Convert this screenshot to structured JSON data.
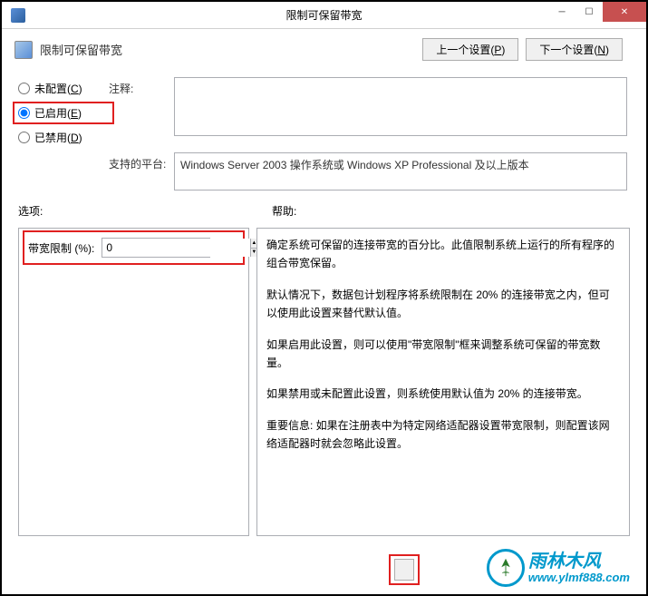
{
  "window": {
    "title": "限制可保留带宽"
  },
  "header": {
    "title": "限制可保留带宽",
    "prev_btn": "上一个设置(",
    "prev_accel": "P",
    "prev_btn_close": ")",
    "next_btn": "下一个设置(",
    "next_accel": "N",
    "next_btn_close": ")"
  },
  "radios": {
    "not_configured": "未配置(",
    "not_configured_accel": "C",
    "not_configured_close": ")",
    "enabled": "已启用(",
    "enabled_accel": "E",
    "enabled_close": ")",
    "disabled": "已禁用(",
    "disabled_accel": "D",
    "disabled_close": ")",
    "selected": "enabled"
  },
  "labels": {
    "comment": "注释:",
    "platform": "支持的平台:",
    "options": "选项:",
    "help": "帮助:"
  },
  "platform_text": "Windows Server 2003 操作系统或 Windows XP Professional 及以上版本",
  "options": {
    "bandwidth_label": "带宽限制 (%):",
    "bandwidth_value": "0"
  },
  "help_text": {
    "p1": "确定系统可保留的连接带宽的百分比。此值限制系统上运行的所有程序的组合带宽保留。",
    "p2": "默认情况下，数据包计划程序将系统限制在 20% 的连接带宽之内，但可以使用此设置来替代默认值。",
    "p3": "如果启用此设置，则可以使用\"带宽限制\"框来调整系统可保留的带宽数量。",
    "p4": "如果禁用或未配置此设置，则系统使用默认值为 20% 的连接带宽。",
    "p5": "重要信息: 如果在注册表中为特定网络适配器设置带宽限制，则配置该网络适配器时就会忽略此设置。"
  },
  "watermark": {
    "cn": "雨林木风",
    "url": "www.ylmf888.com"
  }
}
